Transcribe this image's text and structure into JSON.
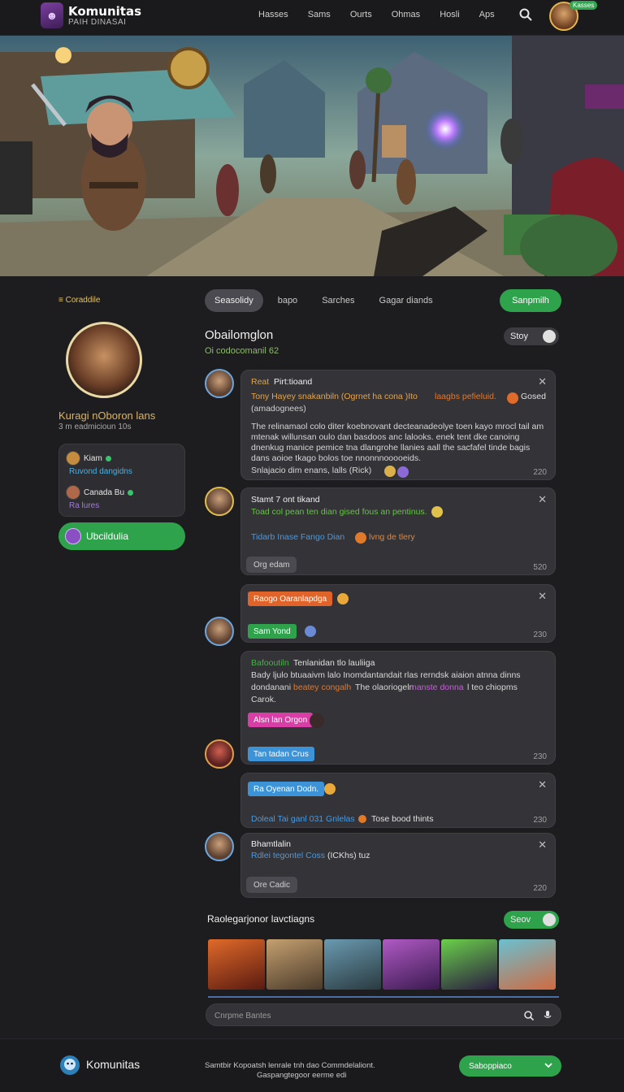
{
  "header": {
    "brand_title": "Komunitas",
    "brand_subtitle": "PAIH DINASAI",
    "nav": [
      "Hasses",
      "Sams",
      "Ourts",
      "Ohmas",
      "Hosli",
      "Aps"
    ],
    "user_badge": "Kasses"
  },
  "left": {
    "heading": "≡ Coraddile",
    "profile_name": "Kuragi nOboron lans",
    "profile_meta": "3 m eadmicioun 10s",
    "friends": [
      {
        "name": "Kiam",
        "sub": "Ruvond dangidns"
      },
      {
        "name": "Canada Bu",
        "sub": "Ra lures"
      }
    ],
    "join_label": "Ubcildulia"
  },
  "tabs": [
    "Seasolidy",
    "bapo",
    "Sarches",
    "Gagar diands"
  ],
  "primary_button": "Sanpmilh",
  "feed": {
    "title": "Obailomglon",
    "subtitle": "Oi codocomanil 62",
    "toggle_label": "Stoy"
  },
  "posts": [
    {
      "title": "Pirt:tioand",
      "title_prefix": "Reat",
      "line1": "Tony Hayey snakanbiln (Ogrnet ha cona )Ito",
      "line1_orange": "laagbs pefieluid.",
      "line1_end": "Gosed",
      "line2": "(amadognees)",
      "body": "The relinamaol colo diter koebnovant decteanadeolye toen kayo mrocl tail am mtenak willunsan oulo dan basdoos anc lalooks. enek tent dke canoing dnenkug manice pemice tna dlangrohe llanies aall the sacfafel tinde bagis dans aoioe tkago bolos toe nnonnnooooeids.",
      "body_end": "Snlajacio dim enans, lalls (Rick)",
      "time": "220"
    },
    {
      "title": "Stamt 7 ont tikand",
      "line1": "Toad col pean ten dian gised fous an pentinus.",
      "line2": "Tidarb Inase Fango Dian",
      "line2_end": "lvng de tlery",
      "button": "Org edam",
      "time": "520"
    },
    {
      "tag1": "Raogo Oaranlapdga",
      "tag2": "Sam Yond",
      "time": "230"
    },
    {
      "line1_green": "Bafooutiln",
      "line1": "Tenlanidan tlo lauliiga",
      "line2": "Bady ljulo btuaaivm lalo Inomdantandait rlas rerndsk aiaion atnna dinns",
      "line3": "dondanani",
      "line3_orange": "beatey congalh",
      "line3_mid": "The olaoriogeln",
      "line3_purple": "nanste donna",
      "line3_end": "l teo chiopms",
      "line4": "Carok.",
      "tag_pink": "Alsn lan Orgon",
      "tag_blue": "Tan tadan Crus",
      "time": "230"
    },
    {
      "tag_blue": "Ra Oyenan Dodn.",
      "line1": "Doleal Tai ganl 031 Gnlelas",
      "line1_end": "Tose bood thints",
      "time": "230"
    },
    {
      "title": "Bhamtlalin",
      "line1": "Rdlei tegontel Coss",
      "line1_end": "(ICKhs) tuz",
      "button": "Ore Cadic",
      "time": "220"
    }
  ],
  "gallery": {
    "title": "Raolegarjonor lavctiagns",
    "toggle_label": "Seov"
  },
  "search": {
    "placeholder": "Cnrpme Bantes"
  },
  "footer": {
    "brand": "Komunitas",
    "text_line1": "Samtbir Kopoatsh lenrale tnh dao Commdelaliont.",
    "text_line2": "Gaspangtegoor eerme edi",
    "button": "Saboppiaco"
  },
  "colors": {
    "accent_green": "#2ea34c",
    "accent_orange": "#e0782e",
    "accent_blue": "#3c93d8",
    "accent_pink": "#d93ea6",
    "background": "#1d1d1f",
    "card": "#333338"
  }
}
